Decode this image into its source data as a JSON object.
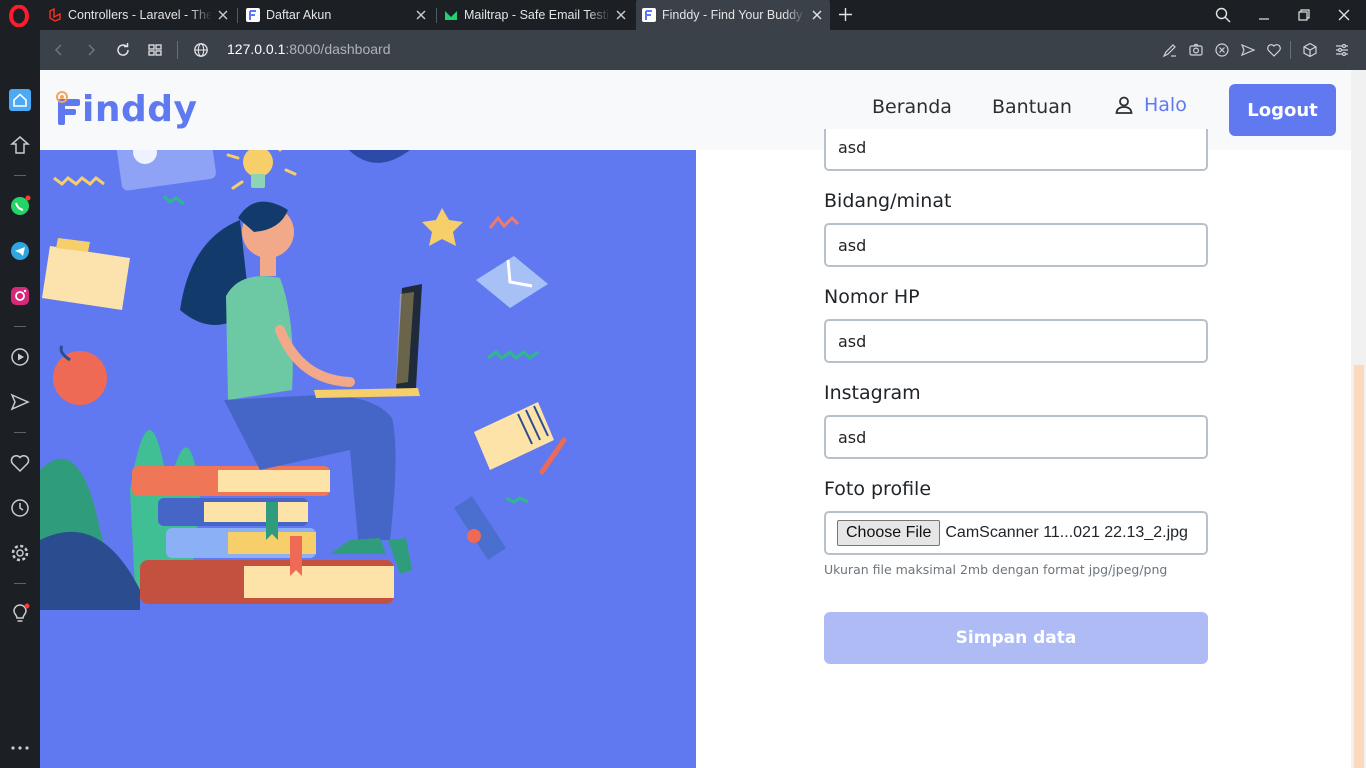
{
  "browser": {
    "tabs": [
      {
        "title": "Controllers - Laravel - The PHP Framework",
        "favicon": "laravel-icon",
        "active": false
      },
      {
        "title": "Daftar Akun",
        "favicon": "finddy-icon",
        "active": false
      },
      {
        "title": "Mailtrap - Safe Email Testing",
        "favicon": "mailtrap-icon",
        "active": false
      },
      {
        "title": "Finddy - Find Your Buddy to",
        "favicon": "finddy-icon",
        "active": true
      }
    ],
    "url_host": "127.0.0.1",
    "url_rest": ":8000/dashboard",
    "accent": "#ff1b2d"
  },
  "navbar": {
    "brand": "inddy",
    "links": {
      "home": "Beranda",
      "help": "Bantuan"
    },
    "user_label": "Halo",
    "logout": "Logout"
  },
  "form": {
    "top_partial_value": "asd",
    "fields": [
      {
        "label": "Bidang/minat",
        "value": "asd"
      },
      {
        "label": "Nomor HP",
        "value": "asd"
      },
      {
        "label": "Instagram",
        "value": "asd"
      }
    ],
    "photo": {
      "label": "Foto profile",
      "button": "Choose File",
      "filename": "CamScanner 11...021 22.13_2.jpg",
      "help": "Ukuran file maksimal 2mb dengan format jpg/jpeg/png"
    },
    "submit": "Simpan data"
  },
  "colors": {
    "primary": "#6079f1",
    "hero_bg": "#6079f1",
    "submit_disabled": "#aebbf5"
  }
}
